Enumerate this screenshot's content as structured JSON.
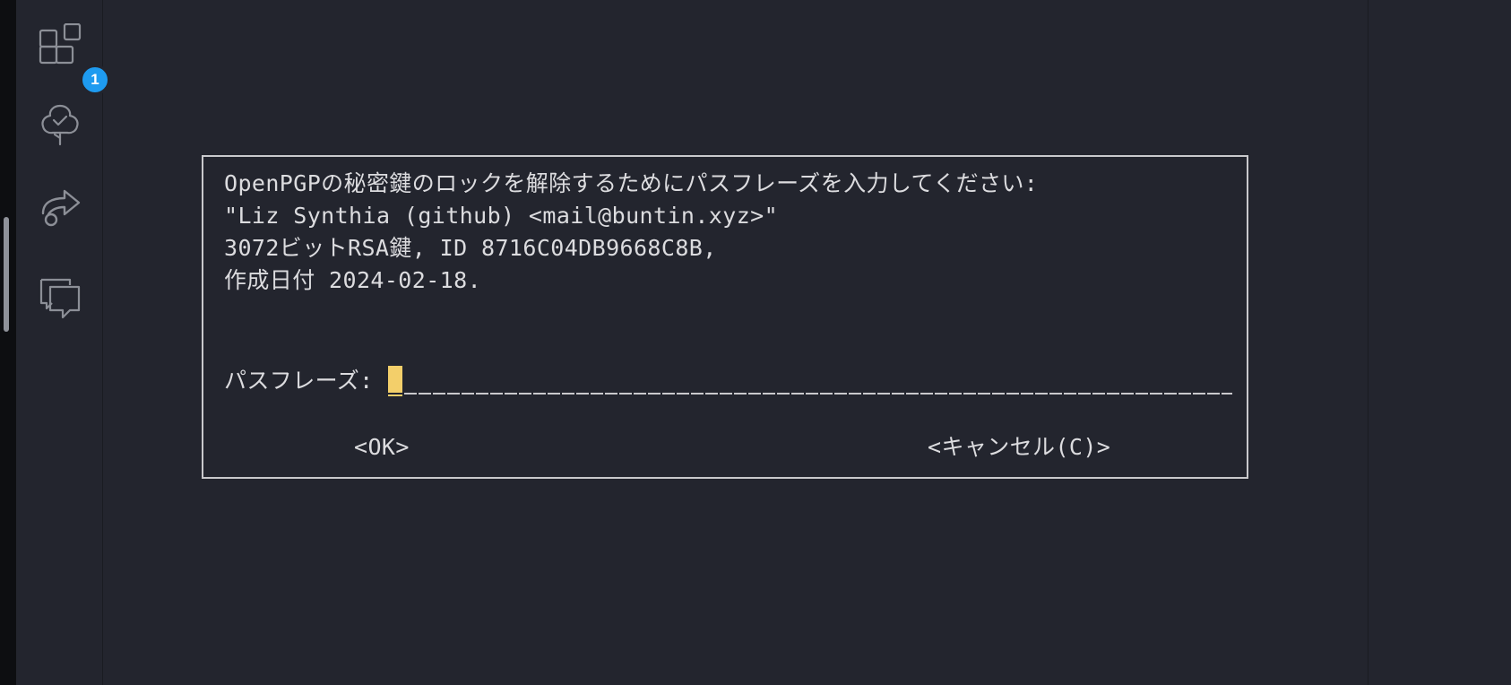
{
  "activity_bar": {
    "items": [
      {
        "icon": "extensions-icon",
        "badge": "1"
      },
      {
        "icon": "tree-check-icon"
      },
      {
        "icon": "source-control-share-icon"
      },
      {
        "icon": "chat-icon"
      }
    ],
    "badge_color": "#1e9bf0"
  },
  "dialog": {
    "line1": "OpenPGPの秘密鍵のロックを解除するためにパスフレーズを入力してください:",
    "line2": "\"Liz Synthia (github) <mail@buntin.xyz>\"",
    "line3": "3072ビットRSA鍵, ID 8716C04DB9668C8B,",
    "line4": "作成日付 2024-02-18.",
    "passphrase_label": "パスフレーズ:",
    "passphrase_value": "",
    "ok_label": "<OK>",
    "cancel_label": "<キャンセル(C)>"
  },
  "colors": {
    "background": "#23252e",
    "border": "#c9c9cc",
    "text": "#dcdcdf",
    "cursor": "#f3cf6a"
  }
}
